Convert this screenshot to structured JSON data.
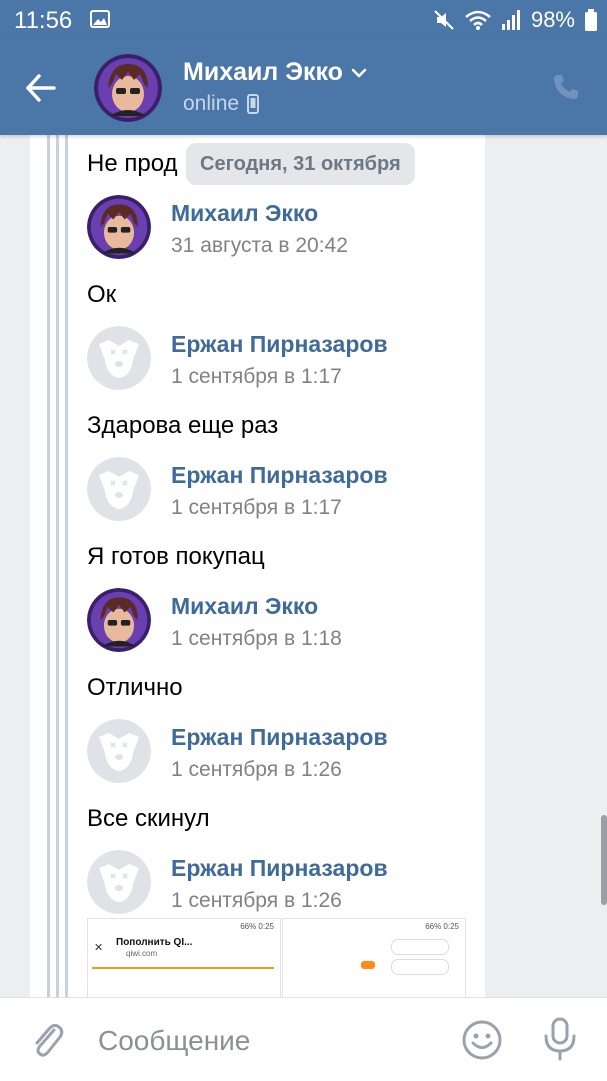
{
  "status_bar": {
    "time": "11:56",
    "battery": "98%",
    "icons": [
      "image-icon",
      "mute-icon",
      "wifi-icon",
      "signal-icon",
      "battery-icon"
    ]
  },
  "header": {
    "name": "Михаил Экко",
    "status": "online",
    "icons": [
      "back-arrow-icon",
      "chevron-down-icon",
      "mobile-icon",
      "phone-icon"
    ]
  },
  "chat": {
    "date_pill": "Сегодня, 31 октября",
    "top_text": "Не прод",
    "messages": [
      {
        "author": "Михаил Экко",
        "time": "31 августа в 20:42",
        "text": "Ок",
        "avatar": "photo"
      },
      {
        "author": "Ержан Пирназаров",
        "time": "1 сентября в 1:17",
        "text": "Здарова еще раз",
        "avatar": "deactivated-dog"
      },
      {
        "author": "Ержан Пирназаров",
        "time": "1 сентября в 1:17",
        "text": "Я готов покупац",
        "avatar": "deactivated-dog"
      },
      {
        "author": "Михаил Экко",
        "time": "1 сентября в 1:18",
        "text": "Отлично",
        "avatar": "photo"
      },
      {
        "author": "Ержан Пирназаров",
        "time": "1 сентября в 1:26",
        "text": "Все скинул",
        "avatar": "deactivated-dog"
      },
      {
        "author": "Ержан Пирназаров",
        "time": "1 сентября в 1:26",
        "text": "",
        "avatar": "deactivated-dog"
      }
    ],
    "attachments": [
      {
        "status": "66% 0:25",
        "title": "Пополнить QI...",
        "domain": "qiwi.com"
      },
      {
        "status": "66% 0:25"
      }
    ]
  },
  "composer": {
    "placeholder": "Сообщение",
    "icons": [
      "attach-icon",
      "emoji-icon",
      "microphone-icon"
    ]
  },
  "colors": {
    "header": "#4a76a8",
    "name_link": "#3f6a9a",
    "timestamp": "#828282",
    "background": "#edeef0"
  }
}
